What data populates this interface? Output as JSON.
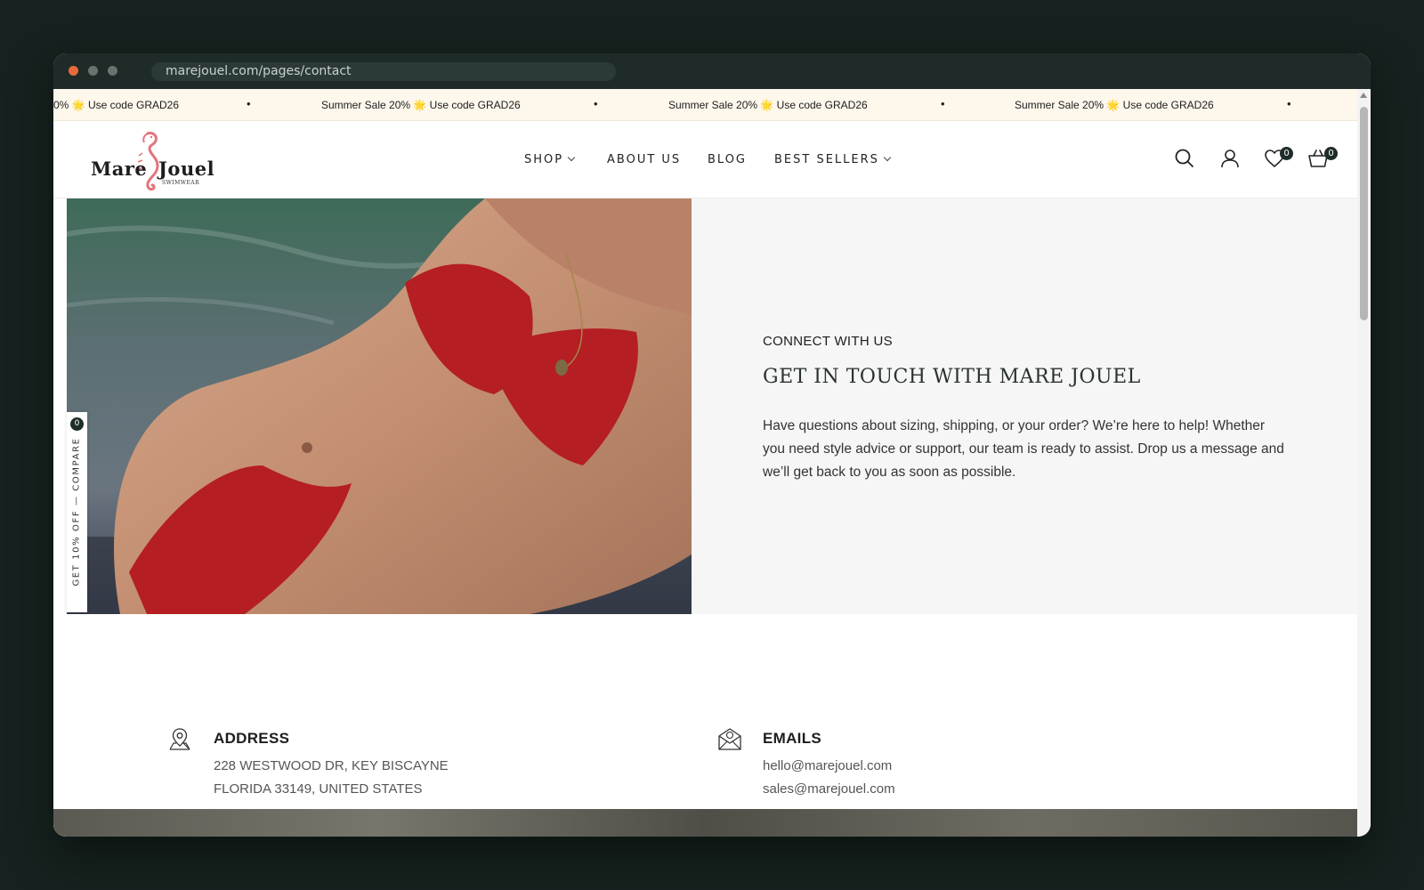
{
  "browser": {
    "url": "marejouel.com/pages/contact"
  },
  "announcement": {
    "text": "Summer Sale 20% 🌟 Use code GRAD26",
    "partial": "0% 🌟 Use code GRAD26",
    "bullet": "•"
  },
  "header": {
    "logo": {
      "word1": "Mare",
      "word2": "Jouel",
      "tagline": "SWIMWEAR"
    },
    "nav": [
      {
        "label": "SHOP"
      },
      {
        "label": "ABOUT US"
      },
      {
        "label": "BLOG"
      },
      {
        "label": "BEST SELLERS"
      }
    ],
    "icons": [
      "search-icon",
      "account-icon",
      "wishlist-icon",
      "cart-icon"
    ],
    "wishlist_count": "0",
    "cart_count": "0"
  },
  "side_tab": {
    "text": "GET 10% OFF — COMPARE",
    "count": "0"
  },
  "hero": {
    "eyebrow": "CONNECT WITH US",
    "heading": "GET IN TOUCH WITH MARE JOUEL",
    "body": "Have questions about sizing, shipping, or your order? We’re here to help! Whether you need style advice or support, our team is ready to assist. Drop us a message and we’ll get back to you as soon as possible."
  },
  "info": {
    "address": {
      "title": "ADDRESS",
      "line1": "228 WESTWOOD DR, KEY BISCAYNE",
      "line2": "FLORIDA 33149, UNITED STATES"
    },
    "emails": {
      "title": "EMAILS",
      "line1": "hello@marejouel.com",
      "line2": "sales@marejouel.com"
    }
  },
  "colors": {
    "accent": "#1f2d2a",
    "banner": "#fdf7ec",
    "logo_seahorse": "#e4747c"
  }
}
